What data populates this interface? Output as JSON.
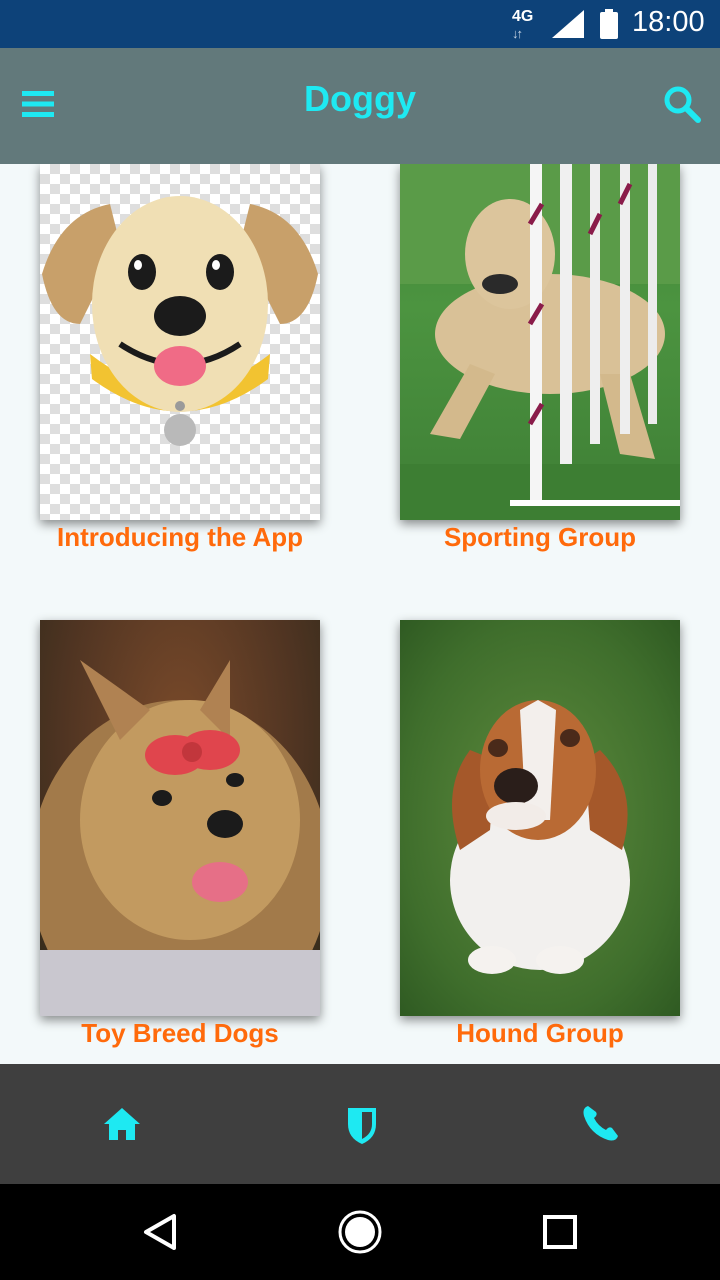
{
  "status_bar": {
    "network": "4G",
    "time": "18:00",
    "icons": [
      "signal-icon",
      "battery-icon"
    ]
  },
  "app_bar": {
    "title": "Doggy",
    "menu_icon": "hamburger-menu-icon",
    "search_icon": "search-icon"
  },
  "cards": [
    {
      "label": "Introducing the App",
      "image": "cartoon-labrador-emoji"
    },
    {
      "label": "Sporting Group",
      "image": "labrador-agility-weave-poles"
    },
    {
      "label": "Toy Breed Dogs",
      "image": "yorkshire-terrier-with-bow"
    },
    {
      "label": "Hound Group",
      "image": "basset-hound-on-grass"
    }
  ],
  "bottom_nav": {
    "items": [
      "home-icon",
      "shield-icon",
      "phone-icon"
    ]
  },
  "system_nav": {
    "items": [
      "back-icon",
      "home-circle-icon",
      "recent-apps-icon"
    ]
  },
  "colors": {
    "status_bar": "#0d4279",
    "app_bar": "#62797b",
    "accent": "#1ee9f2",
    "label": "#ff6a0b",
    "bottom_nav": "#3f3f3f",
    "background": "#f3f9fa"
  }
}
